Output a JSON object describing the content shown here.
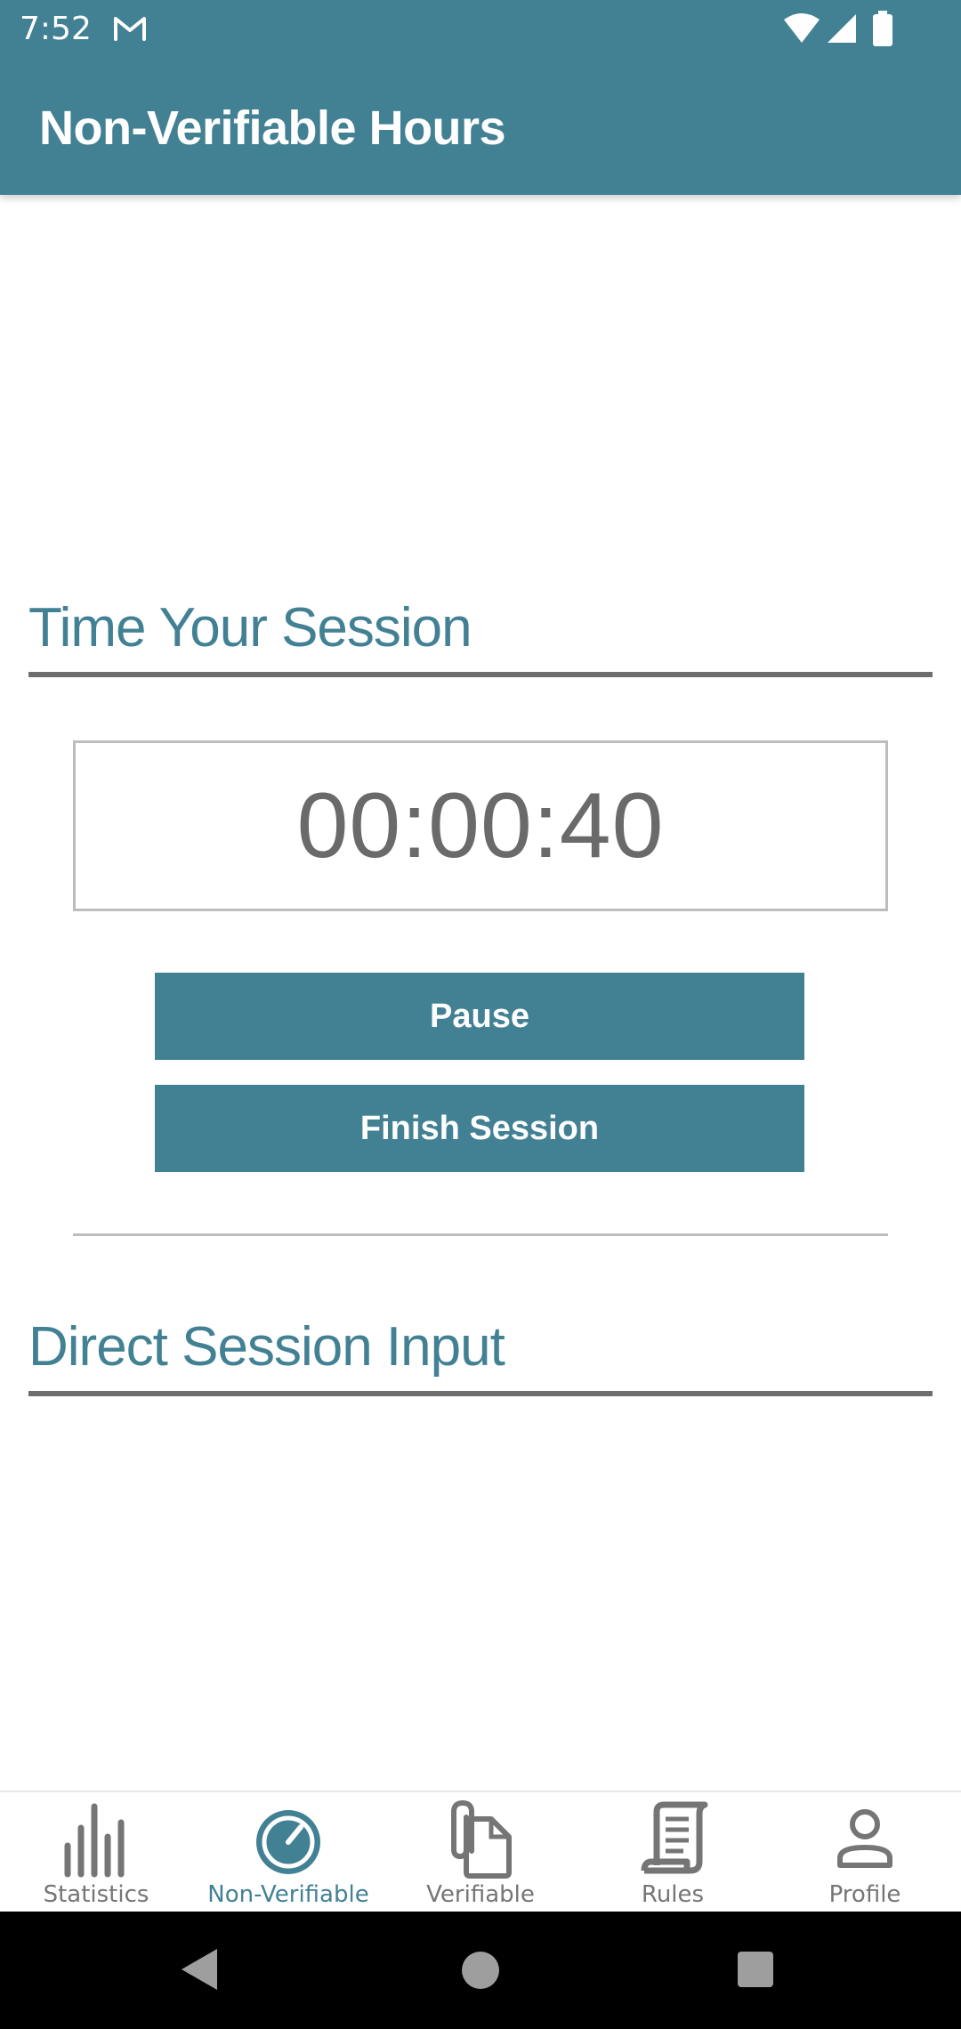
{
  "status_bar": {
    "time": "7:52",
    "notification_icon": "gmail-icon",
    "indicators": [
      "wifi-icon",
      "signal-icon",
      "battery-icon"
    ]
  },
  "app_bar": {
    "title": "Non-Verifiable Hours"
  },
  "timer_section": {
    "heading": "Time Your Session",
    "elapsed": "00:00:40",
    "pause_label": "Pause",
    "finish_label": "Finish Session"
  },
  "direct_input_section": {
    "heading": "Direct Session Input"
  },
  "bottom_nav": {
    "selected": "Non-Verifiable",
    "items": [
      {
        "label": "Statistics",
        "icon": "bar-chart-icon"
      },
      {
        "label": "Non-Verifiable",
        "icon": "stopwatch-icon"
      },
      {
        "label": "Verifiable",
        "icon": "paperclip-document-icon"
      },
      {
        "label": "Rules",
        "icon": "scroll-document-icon"
      },
      {
        "label": "Profile",
        "icon": "person-icon"
      }
    ]
  },
  "system_nav": {
    "buttons": [
      "back-icon",
      "home-icon",
      "recents-icon"
    ]
  },
  "colors": {
    "primary": "#428194",
    "heading_rule": "#6e6e6e",
    "timer_text": "#6a6a6a",
    "inactive_nav": "#757575",
    "background": "#ffffff",
    "system_nav_background": "#000000"
  }
}
